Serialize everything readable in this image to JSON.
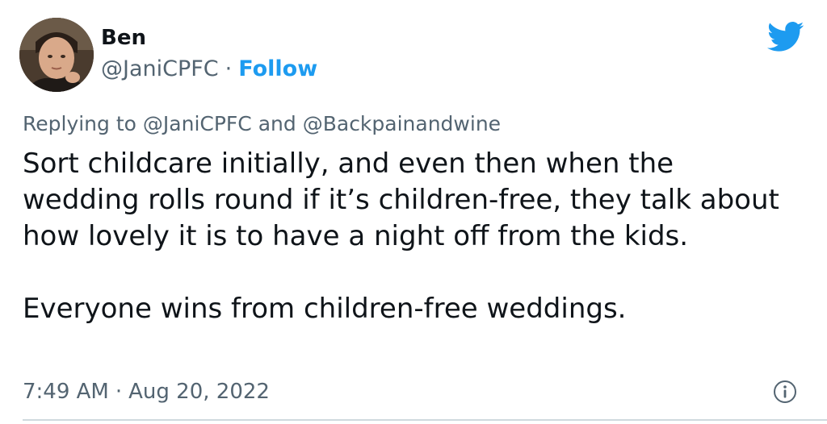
{
  "author": {
    "name": "Ben",
    "handle": "@JaniCPFC",
    "separator": "·",
    "follow_label": "Follow"
  },
  "reply": {
    "prefix": "Replying to",
    "to_1": "@JaniCPFC",
    "conjunction": "and",
    "to_2": "@Backpainandwine"
  },
  "tweet": {
    "paragraph_1": "Sort childcare initially, and even then when the wedding rolls round if it’s children-free, they talk about how lovely it is to have a night off from the kids.",
    "paragraph_2": "Everyone wins from children-free weddings."
  },
  "meta": {
    "time": "7:49 AM",
    "separator": "·",
    "date": "Aug 20, 2022"
  },
  "icons": {
    "brand": "twitter-bird-icon",
    "info": "info-icon"
  },
  "colors": {
    "accent": "#1d9bf0",
    "text": "#0f1419",
    "secondary": "#536471"
  }
}
